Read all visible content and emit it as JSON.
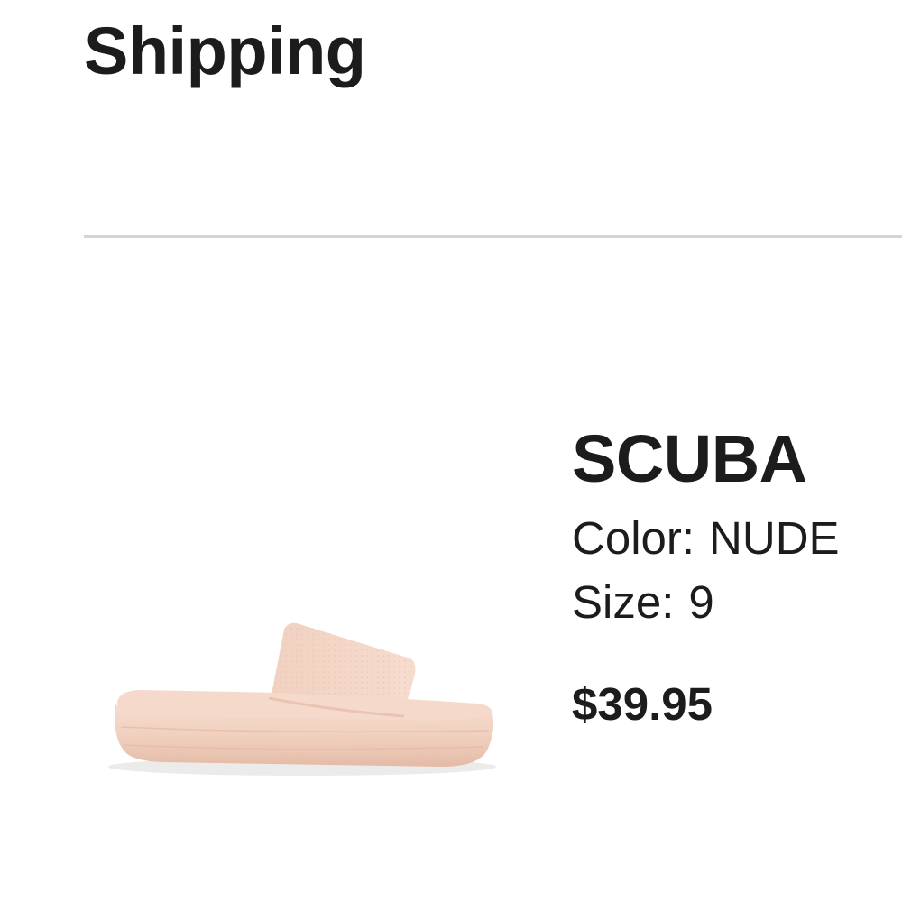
{
  "section": {
    "title": "Shipping"
  },
  "product": {
    "name": "SCUBA",
    "color_label": "Color:",
    "color_value": "NUDE",
    "size_label": "Size:",
    "size_value": "9",
    "price": "$39.95",
    "image_icon": "sandal-slide-image",
    "product_color_hex": "#f2d3c3"
  }
}
